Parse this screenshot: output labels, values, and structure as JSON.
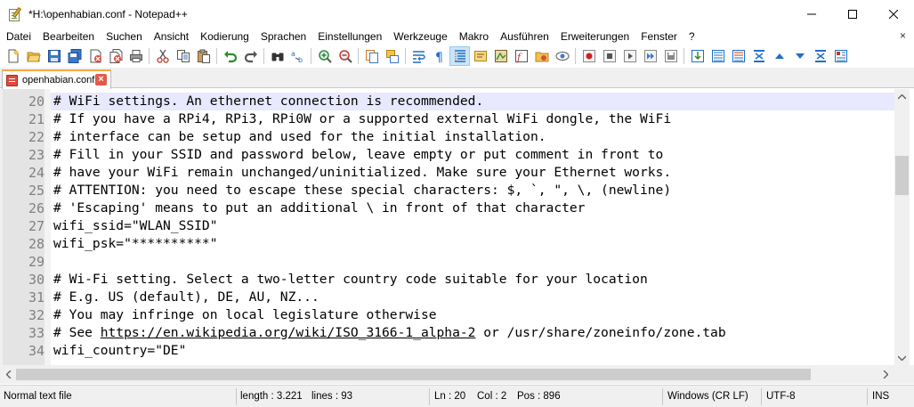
{
  "window": {
    "title": "*H:\\openhabian.conf - Notepad++"
  },
  "menu": {
    "items": [
      "Datei",
      "Bearbeiten",
      "Suchen",
      "Ansicht",
      "Kodierung",
      "Sprachen",
      "Einstellungen",
      "Werkzeuge",
      "Makro",
      "Ausführen",
      "Erweiterungen",
      "Fenster",
      "?"
    ],
    "close_glyph": "×"
  },
  "tabs": [
    {
      "label": "openhabian.conf",
      "close_glyph": "×"
    }
  ],
  "editor": {
    "current_line": 20,
    "lines": [
      {
        "num": "20",
        "text": "# WiFi settings. An ethernet connection is recommended."
      },
      {
        "num": "21",
        "text": "# If you have a RPi4, RPi3, RPi0W or a supported external WiFi dongle, the WiFi"
      },
      {
        "num": "22",
        "text": "# interface can be setup and used for the initial installation."
      },
      {
        "num": "23",
        "text": "# Fill in your SSID and password below, leave empty or put comment in front to"
      },
      {
        "num": "24",
        "text": "# have your WiFi remain unchanged/uninitialized. Make sure your Ethernet works."
      },
      {
        "num": "25",
        "text": "# ATTENTION: you need to escape these special characters: $, `, \", \\, (newline)"
      },
      {
        "num": "26",
        "text": "# 'Escaping' means to put an additional \\ in front of that character"
      },
      {
        "num": "27",
        "text": "wifi_ssid=\"WLAN_SSID\""
      },
      {
        "num": "28",
        "text": "wifi_psk=\"**********\""
      },
      {
        "num": "29",
        "text": ""
      },
      {
        "num": "30",
        "text": "# Wi-Fi setting. Select a two-letter country code suitable for your location"
      },
      {
        "num": "31",
        "text": "# E.g. US (default), DE, AU, NZ..."
      },
      {
        "num": "32",
        "text": "# You may infringe on local legislature otherwise"
      },
      {
        "num": "33",
        "text_before": "# See ",
        "link": "https://en.wikipedia.org/wiki/ISO_3166-1_alpha-2",
        "text_after": " or /usr/share/zoneinfo/zone.tab"
      },
      {
        "num": "34",
        "text": "wifi_country=\"DE\""
      }
    ]
  },
  "status": {
    "file_type": "Normal text file",
    "length": "length : 3.221",
    "lines": "lines : 93",
    "ln": "Ln : 20",
    "col": "Col : 2",
    "pos": "Pos : 896",
    "eol": "Windows (CR LF)",
    "encoding": "UTF-8",
    "mode": "INS"
  },
  "toolbar": {
    "icons": [
      "new-file-icon",
      "open-file-icon",
      "save-icon",
      "save-all-icon",
      "close-icon",
      "close-all-icon",
      "print-icon",
      "cut-icon",
      "copy-icon",
      "paste-icon",
      "undo-icon",
      "redo-icon",
      "find-icon",
      "replace-icon",
      "zoom-in-icon",
      "zoom-out-icon",
      "sync-vertical-icon",
      "sync-horizontal-icon",
      "word-wrap-icon",
      "show-all-chars-icon",
      "indent-guide-icon",
      "udl-icon",
      "doc-map-icon",
      "function-list-icon",
      "folder-workspace-icon",
      "monitoring-icon",
      "record-macro-icon",
      "stop-macro-icon",
      "play-macro-icon",
      "run-macro-multiple-icon",
      "save-macro-icon",
      "extra-1-icon",
      "extra-2-icon",
      "extra-3-icon",
      "extra-4-icon",
      "extra-5-icon",
      "extra-6-icon",
      "extra-7-icon",
      "extra-8-icon"
    ],
    "accent": "#1f6fc5"
  }
}
